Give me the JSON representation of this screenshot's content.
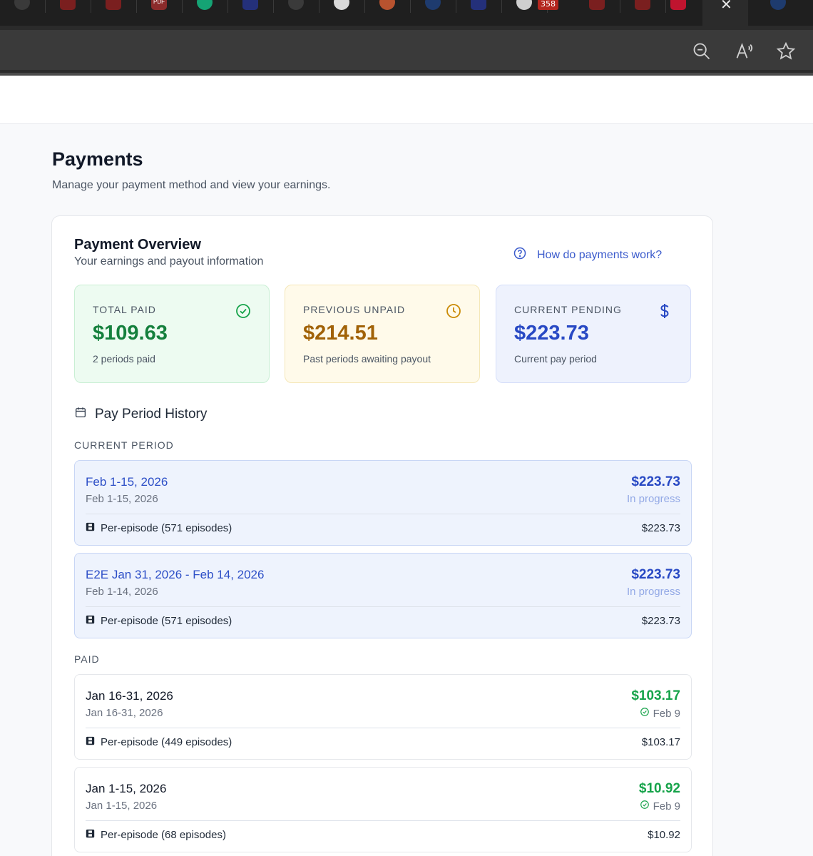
{
  "browser": {
    "tab_badge": "358",
    "tab_pdf_label": "PDF"
  },
  "page": {
    "title": "Payments",
    "subtitle": "Manage your payment method and view your earnings."
  },
  "overview": {
    "title": "Payment Overview",
    "subtitle": "Your earnings and payout information",
    "help_link": "How do payments work?",
    "stats": [
      {
        "label": "TOTAL PAID",
        "value": "$109.63",
        "sub": "2 periods paid",
        "icon": "check-circle-icon"
      },
      {
        "label": "PREVIOUS UNPAID",
        "value": "$214.51",
        "sub": "Past periods awaiting payout",
        "icon": "clock-icon"
      },
      {
        "label": "CURRENT PENDING",
        "value": "$223.73",
        "sub": "Current pay period",
        "icon": "dollar-icon"
      }
    ]
  },
  "history": {
    "title": "Pay Period History",
    "current_label": "CURRENT PERIOD",
    "paid_label": "PAID",
    "current": [
      {
        "name": "Feb 1-15, 2026",
        "range": "Feb 1-15, 2026",
        "amount": "$223.73",
        "status": "In progress",
        "line": "Per-episode (571 episodes)",
        "line_amount": "$223.73"
      },
      {
        "name": "E2E Jan 31, 2026 - Feb 14, 2026",
        "range": "Feb 1-14, 2026",
        "amount": "$223.73",
        "status": "In progress",
        "line": "Per-episode (571 episodes)",
        "line_amount": "$223.73"
      }
    ],
    "paid": [
      {
        "name": "Jan 16-31, 2026",
        "range": "Jan 16-31, 2026",
        "amount": "$103.17",
        "status": "Feb 9",
        "line": "Per-episode (449 episodes)",
        "line_amount": "$103.17"
      },
      {
        "name": "Jan 1-15, 2026",
        "range": "Jan 1-15, 2026",
        "amount": "$10.92",
        "status": "Feb 9",
        "line": "Per-episode (68 episodes)",
        "line_amount": "$10.92"
      }
    ]
  },
  "colors": {
    "accent_blue": "#2849c4",
    "paid_green": "#16a34a",
    "unpaid_amber": "#a16207"
  }
}
